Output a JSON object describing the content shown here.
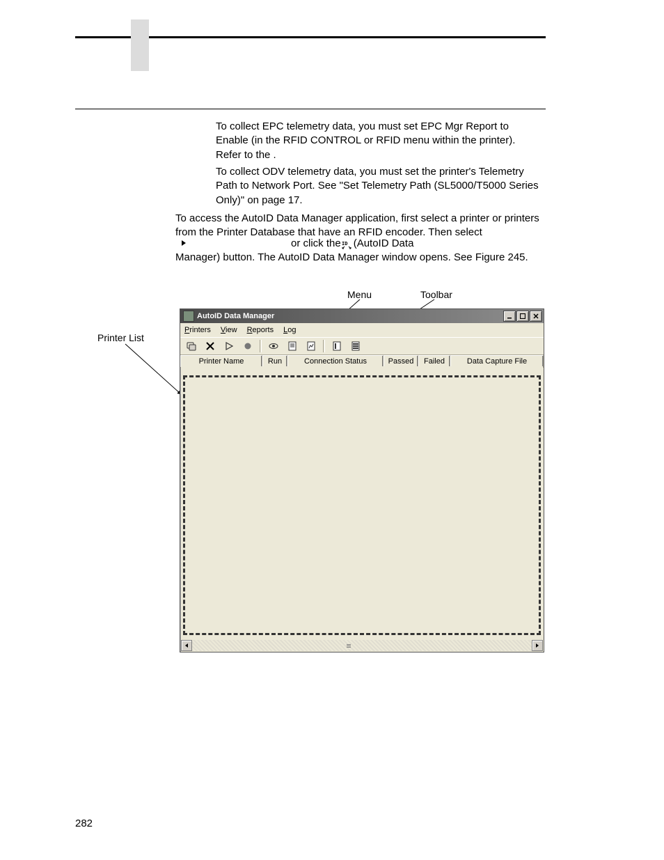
{
  "paragraphs": {
    "p1_a": "To collect EPC telemetry data, you must set EPC Mgr Report to Enable (in the RFID CONTROL or RFID menu within the printer). Refer to the ",
    "p1_b": ".",
    "p2": "To collect ODV telemetry data, you must set the printer's Telemetry Path to Network Port. See \"Set Telemetry Path (SL5000/T5000 Series Only)\" on page 17.",
    "p3": "To access the AutoID Data Manager application, first select a printer or printers from the Printer Database that have an RFID encoder. Then select",
    "p4_mid": "or click the ",
    "p4_end": " (AutoID Data",
    "p5": "Manager) button. The AutoID Data Manager window opens. See Figure 245."
  },
  "callouts": {
    "menu": "Menu",
    "toolbar": "Toolbar",
    "printer_list": "Printer List"
  },
  "window": {
    "title": "AutoID Data Manager",
    "menu": {
      "printers": "Printers",
      "view": "View",
      "reports": "Reports",
      "log": "Log"
    },
    "columns": {
      "printer_name": "Printer Name",
      "run": "Run",
      "connection_status": "Connection Status",
      "passed": "Passed",
      "failed": "Failed",
      "data_capture_file": "Data Capture File"
    }
  },
  "page_number": "282"
}
